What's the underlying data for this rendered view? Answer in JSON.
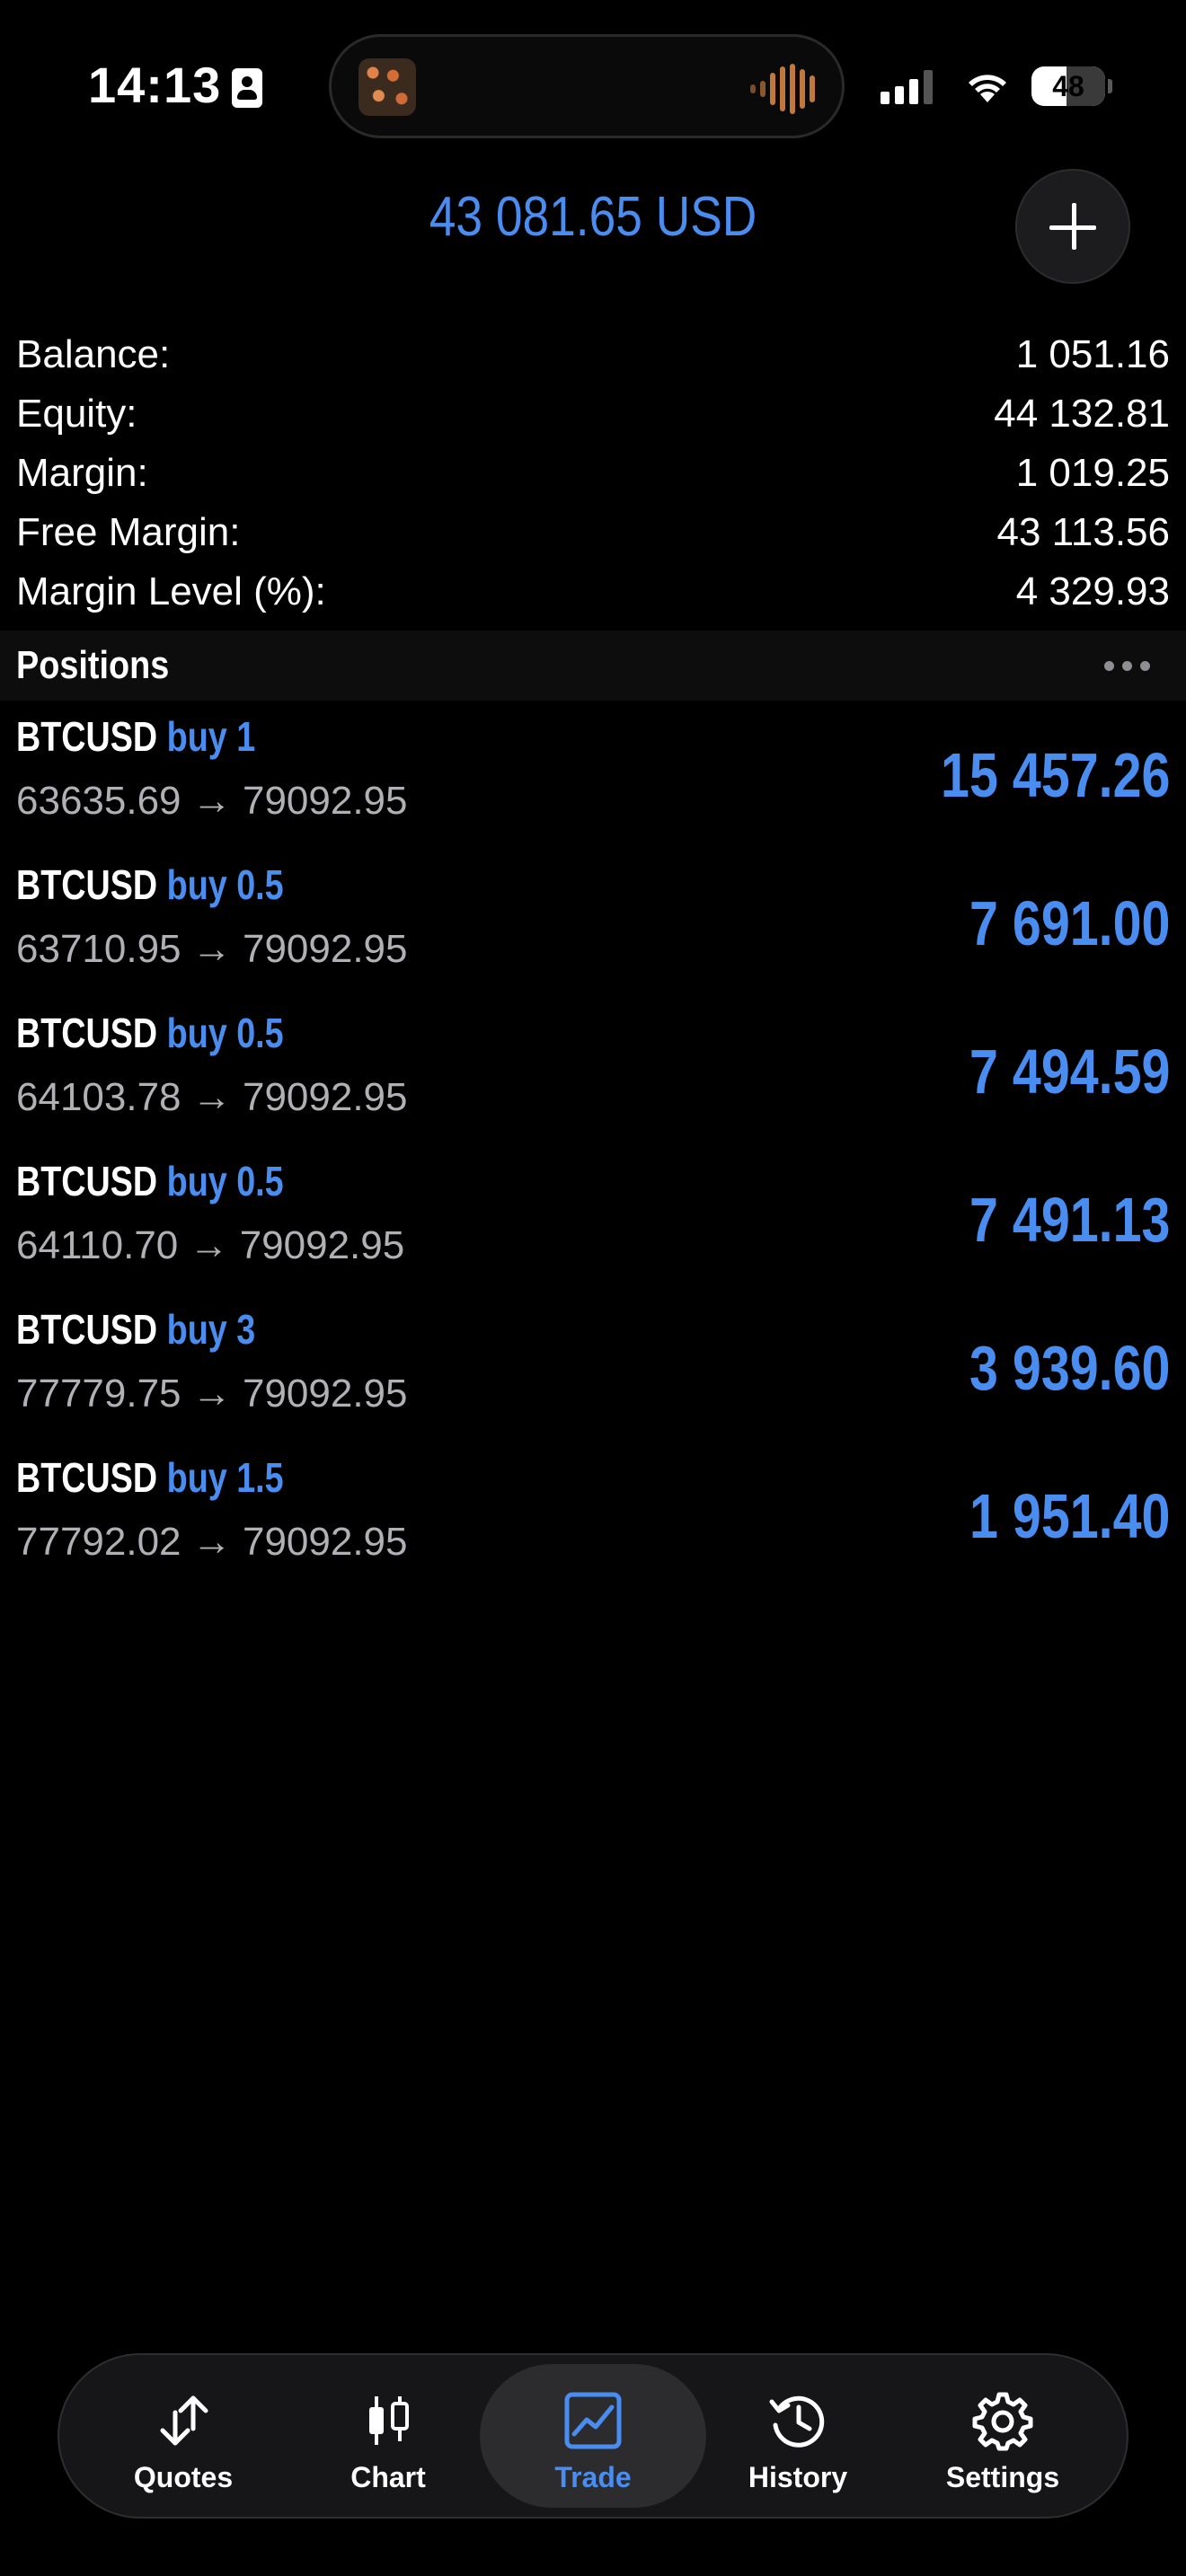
{
  "status_bar": {
    "time": "14:13",
    "battery": "48",
    "battery_level": 0.48
  },
  "header": {
    "total": "43 081.65 USD"
  },
  "summary": [
    {
      "label": "Balance:",
      "value": "1 051.16"
    },
    {
      "label": "Equity:",
      "value": "44 132.81"
    },
    {
      "label": "Margin:",
      "value": "1 019.25"
    },
    {
      "label": "Free Margin:",
      "value": "43 113.56"
    },
    {
      "label": "Margin Level (%):",
      "value": "4 329.93"
    }
  ],
  "positions": {
    "title": "Positions",
    "items": [
      {
        "symbol": "BTCUSD",
        "side": "buy",
        "volume": "1",
        "prices": "63635.69 → 79092.95",
        "profit": "15 457.26"
      },
      {
        "symbol": "BTCUSD",
        "side": "buy",
        "volume": "0.5",
        "prices": "63710.95 → 79092.95",
        "profit": "7 691.00"
      },
      {
        "symbol": "BTCUSD",
        "side": "buy",
        "volume": "0.5",
        "prices": "64103.78 → 79092.95",
        "profit": "7 494.59"
      },
      {
        "symbol": "BTCUSD",
        "side": "buy",
        "volume": "0.5",
        "prices": "64110.70 → 79092.95",
        "profit": "7 491.13"
      },
      {
        "symbol": "BTCUSD",
        "side": "buy",
        "volume": "3",
        "prices": "77779.75 → 79092.95",
        "profit": "3 939.60"
      },
      {
        "symbol": "BTCUSD",
        "side": "buy",
        "volume": "1.5",
        "prices": "77792.02 → 79092.95",
        "profit": "1 951.40"
      }
    ]
  },
  "tab_bar": {
    "tabs": [
      {
        "label": "Quotes",
        "icon": "quotes-arrows-icon",
        "active": false
      },
      {
        "label": "Chart",
        "icon": "candlestick-chart-icon",
        "active": false
      },
      {
        "label": "Trade",
        "icon": "trade-chart-icon",
        "active": true
      },
      {
        "label": "History",
        "icon": "history-clock-icon",
        "active": false
      },
      {
        "label": "Settings",
        "icon": "gear-icon",
        "active": false
      }
    ]
  },
  "colors": {
    "accent": "#4a8df0",
    "background": "#000000",
    "muted_text": "#b0b0b5"
  }
}
